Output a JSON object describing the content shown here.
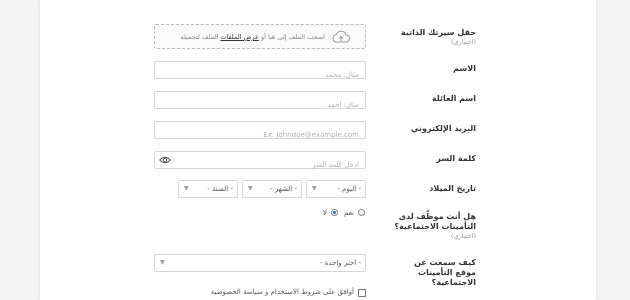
{
  "resume": {
    "label": "حقل سيرتك الذاتية",
    "optional": "(اختياري)",
    "upload_text_before": "اسحب الملف إلى هنا أو",
    "upload_link": "عرض الملفات",
    "upload_text_after": "الملف لتحميله"
  },
  "first_name": {
    "label": "الاسم",
    "placeholder": "مثال: محمد"
  },
  "last_name": {
    "label": "اسم العائلة",
    "placeholder": "مثال: أحمد"
  },
  "email": {
    "label": "البريد الإلكتروني",
    "placeholder": "Ex: Johndoe@example.com"
  },
  "password": {
    "label": "كلمة السر",
    "placeholder": "أدخل كلمة السر"
  },
  "birthdate": {
    "label": "تاريخ الميلاد",
    "day": "- اليوم -",
    "month": "- الشهر -",
    "year": "- السنة -"
  },
  "gosi": {
    "label": "هل أنت موظّف لدى التأمينات الاجتماعية؟",
    "optional": "(اختياري)",
    "yes": "نعم",
    "no": "لا",
    "selected": "no"
  },
  "source": {
    "label": "كيف سمعت عن موقع التأمينات الاجتماعية؟",
    "value": "- اختر واحدة -"
  },
  "terms": {
    "text": "أوافق على شروط الاستخدام و سياسة الخصوصية",
    "checked": false
  }
}
